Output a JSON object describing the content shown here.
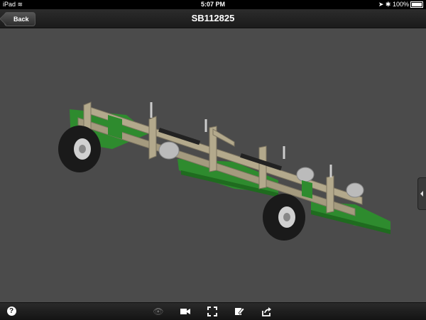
{
  "status_bar": {
    "device": "iPad",
    "time": "5:07 PM",
    "battery": "100%"
  },
  "nav": {
    "back_label": "Back",
    "title": "SB112825"
  },
  "toolbar": {
    "icons": [
      "help-icon",
      "eye-icon",
      "video-icon",
      "expand-icon",
      "markup-icon",
      "share-icon"
    ]
  },
  "colors": {
    "frame": "#b3a98c",
    "green": "#2e8b2e",
    "tire": "#1a1a1a",
    "background": "#4b4b4b"
  }
}
